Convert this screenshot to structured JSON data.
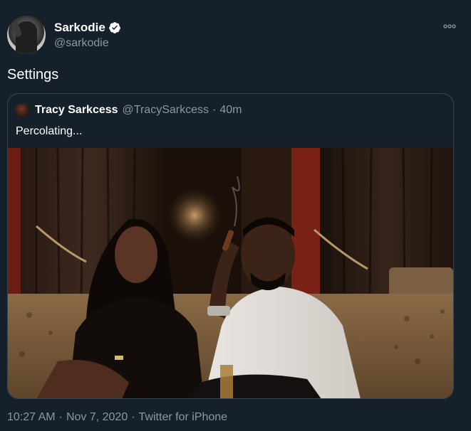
{
  "author": {
    "display_name": "Sarkodie",
    "handle": "@sarkodie",
    "verified": true
  },
  "tweet": {
    "text": "Settings"
  },
  "quoted": {
    "display_name": "Tracy Sarkcess",
    "handle": "@TracySarkcess",
    "separator": "·",
    "time": "40m",
    "text": "Percolating..."
  },
  "meta": {
    "time": "10:27 AM",
    "separator": "·",
    "date": "Nov 7, 2020",
    "source": "Twitter for iPhone"
  },
  "colors": {
    "background": "#15202b",
    "secondary_text": "#8899a6",
    "border": "#38444d",
    "verified_badge": "#ffffff"
  },
  "icons": {
    "verified": "verified-badge-icon",
    "more": "more-options-icon"
  }
}
